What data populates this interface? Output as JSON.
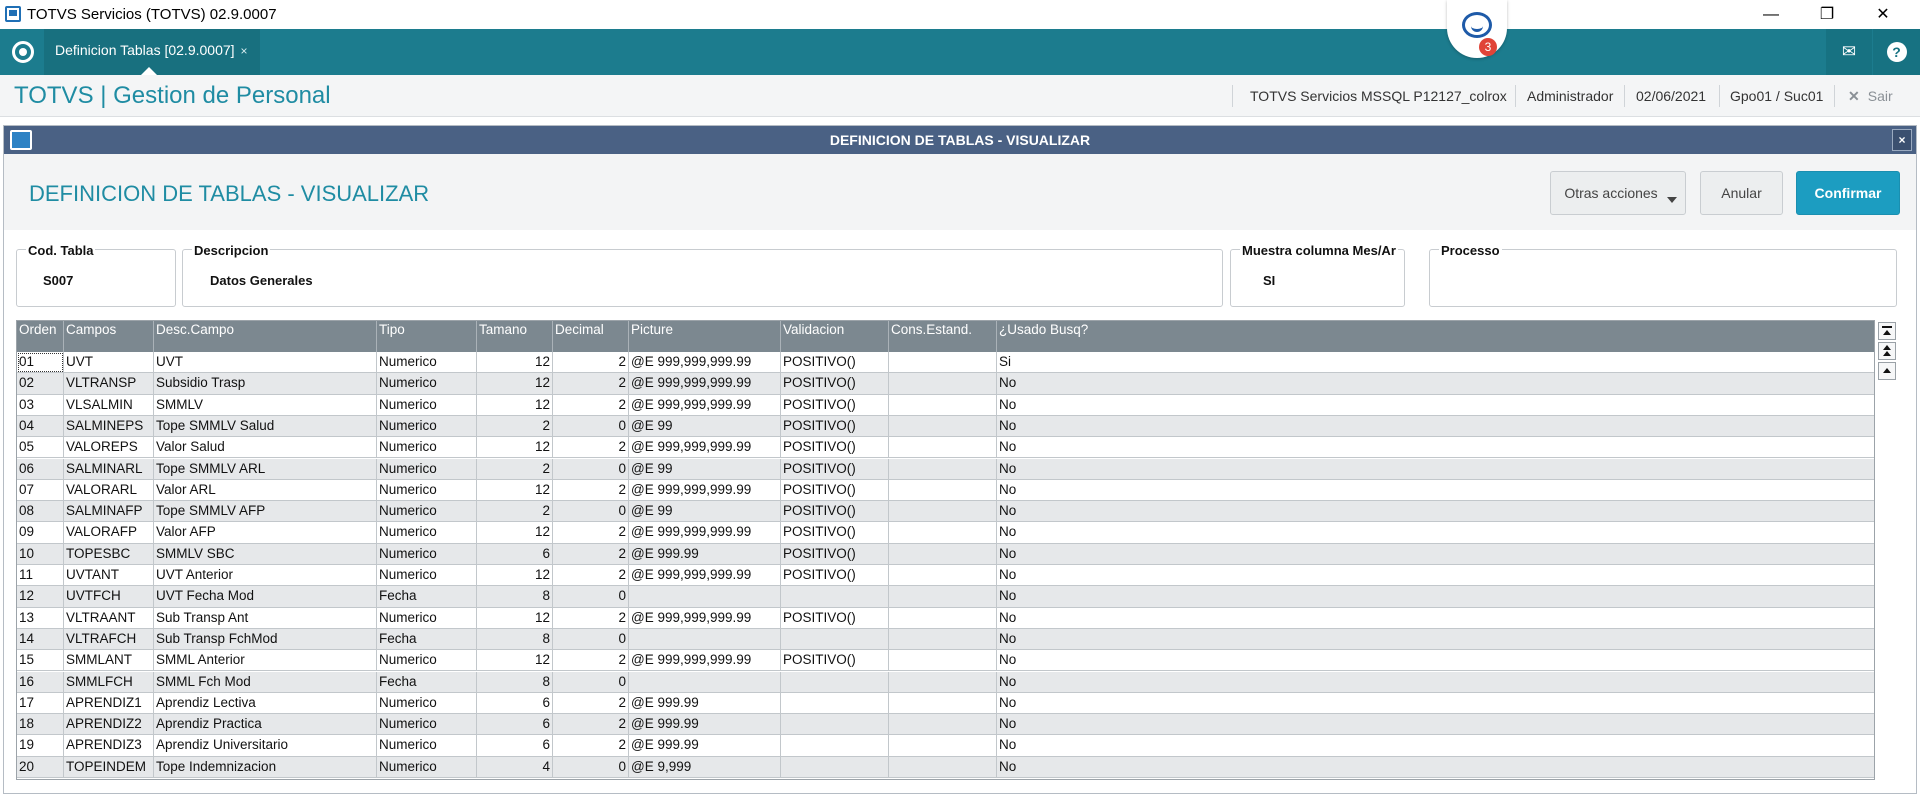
{
  "window": {
    "title": "TOTVS Servicios (TOTVS) 02.9.0007",
    "minimize": "—",
    "maximize": "❐",
    "close": "✕"
  },
  "tabbar": {
    "tab_label": "Definicion Tablas [02.9.0007]",
    "tab_close": "×",
    "chat_badge": "3",
    "mail_glyph": "✉",
    "help_glyph": "?"
  },
  "header": {
    "app_title": "TOTVS | Gestion de Personal",
    "environment": "TOTVS Servicios MSSQL P12127_colrox",
    "user": "Administrador",
    "date": "02/06/2021",
    "branch": "Gpo01 / Suc01",
    "exit_glyph": "✕",
    "exit_label": "Sair"
  },
  "dialog": {
    "title": "DEFINICION DE TABLAS - VISUALIZAR",
    "close_glyph": "×",
    "heading": "DEFINICION DE TABLAS - VISUALIZAR",
    "buttons": {
      "more_actions": "Otras acciones",
      "cancel": "Anular",
      "confirm": "Confirmar"
    },
    "fields": {
      "cod_tabla": {
        "label": "Cod. Tabla",
        "value": "S007"
      },
      "descripcion": {
        "label": "Descripcion",
        "value": "Datos Generales"
      },
      "muestra": {
        "label": "Muestra columna Mes/Ar",
        "value": "SI"
      },
      "processo": {
        "label": "Processo",
        "value": ""
      }
    }
  },
  "grid": {
    "columns": [
      "Orden",
      "Campos",
      "Desc.Campo",
      "Tipo",
      "Tamano",
      "Decimal",
      "Picture",
      "Validacion",
      "Cons.Estand.",
      "¿Usado Busq?"
    ],
    "rows": [
      [
        "01",
        "UVT",
        "UVT",
        "Numerico",
        "12",
        "2",
        "@E 999,999,999.99",
        "POSITIVO()",
        "",
        "Si"
      ],
      [
        "02",
        "VLTRANSP",
        "Subsidio Trasp",
        "Numerico",
        "12",
        "2",
        "@E 999,999,999.99",
        "POSITIVO()",
        "",
        "No"
      ],
      [
        "03",
        "VLSALMIN",
        "SMMLV",
        "Numerico",
        "12",
        "2",
        "@E 999,999,999.99",
        "POSITIVO()",
        "",
        "No"
      ],
      [
        "04",
        "SALMINEPS",
        "Tope SMMLV Salud",
        "Numerico",
        "2",
        "0",
        "@E 99",
        "POSITIVO()",
        "",
        "No"
      ],
      [
        "05",
        "VALOREPS",
        "Valor Salud",
        "Numerico",
        "12",
        "2",
        "@E 999,999,999.99",
        "POSITIVO()",
        "",
        "No"
      ],
      [
        "06",
        "SALMINARL",
        "Tope SMMLV ARL",
        "Numerico",
        "2",
        "0",
        "@E 99",
        "POSITIVO()",
        "",
        "No"
      ],
      [
        "07",
        "VALORARL",
        "Valor ARL",
        "Numerico",
        "12",
        "2",
        "@E 999,999,999.99",
        "POSITIVO()",
        "",
        "No"
      ],
      [
        "08",
        "SALMINAFP",
        "Tope SMMLV AFP",
        "Numerico",
        "2",
        "0",
        "@E 99",
        "POSITIVO()",
        "",
        "No"
      ],
      [
        "09",
        "VALORAFP",
        "Valor AFP",
        "Numerico",
        "12",
        "2",
        "@E 999,999,999.99",
        "POSITIVO()",
        "",
        "No"
      ],
      [
        "10",
        "TOPESBC",
        "SMMLV SBC",
        "Numerico",
        "6",
        "2",
        "@E 999.99",
        "POSITIVO()",
        "",
        "No"
      ],
      [
        "11",
        "UVTANT",
        "UVT Anterior",
        "Numerico",
        "12",
        "2",
        "@E 999,999,999.99",
        "POSITIVO()",
        "",
        "No"
      ],
      [
        "12",
        "UVTFCH",
        "UVT Fecha Mod",
        "Fecha",
        "8",
        "0",
        "",
        "",
        "",
        "No"
      ],
      [
        "13",
        "VLTRAANT",
        "Sub Transp Ant",
        "Numerico",
        "12",
        "2",
        "@E 999,999,999.99",
        "POSITIVO()",
        "",
        "No"
      ],
      [
        "14",
        "VLTRAFCH",
        "Sub Transp FchMod",
        "Fecha",
        "8",
        "0",
        "",
        "",
        "",
        "No"
      ],
      [
        "15",
        "SMMLANT",
        "SMML Anterior",
        "Numerico",
        "12",
        "2",
        "@E 999,999,999.99",
        "POSITIVO()",
        "",
        "No"
      ],
      [
        "16",
        "SMMLFCH",
        "SMML Fch Mod",
        "Fecha",
        "8",
        "0",
        "",
        "",
        "",
        "No"
      ],
      [
        "17",
        "APRENDIZ1",
        "Aprendiz Lectiva",
        "Numerico",
        "6",
        "2",
        "@E 999.99",
        "",
        "",
        "No"
      ],
      [
        "18",
        "APRENDIZ2",
        "Aprendiz Practica",
        "Numerico",
        "6",
        "2",
        "@E 999.99",
        "",
        "",
        "No"
      ],
      [
        "19",
        "APRENDIZ3",
        "Aprendiz Universitario",
        "Numerico",
        "6",
        "2",
        "@E 999.99",
        "",
        "",
        "No"
      ],
      [
        "20",
        "TOPEINDEM",
        "Tope Indemnizacion",
        "Numerico",
        "4",
        "0",
        "@E 9,999",
        "",
        "",
        "No"
      ]
    ]
  },
  "colors": {
    "tabbar": "#1c7c8e",
    "accent": "#1f8ca3",
    "dialog_title": "#4a6184",
    "confirm": "#1c9dc1",
    "grid_header": "#7c8890",
    "badge": "#e04438"
  }
}
